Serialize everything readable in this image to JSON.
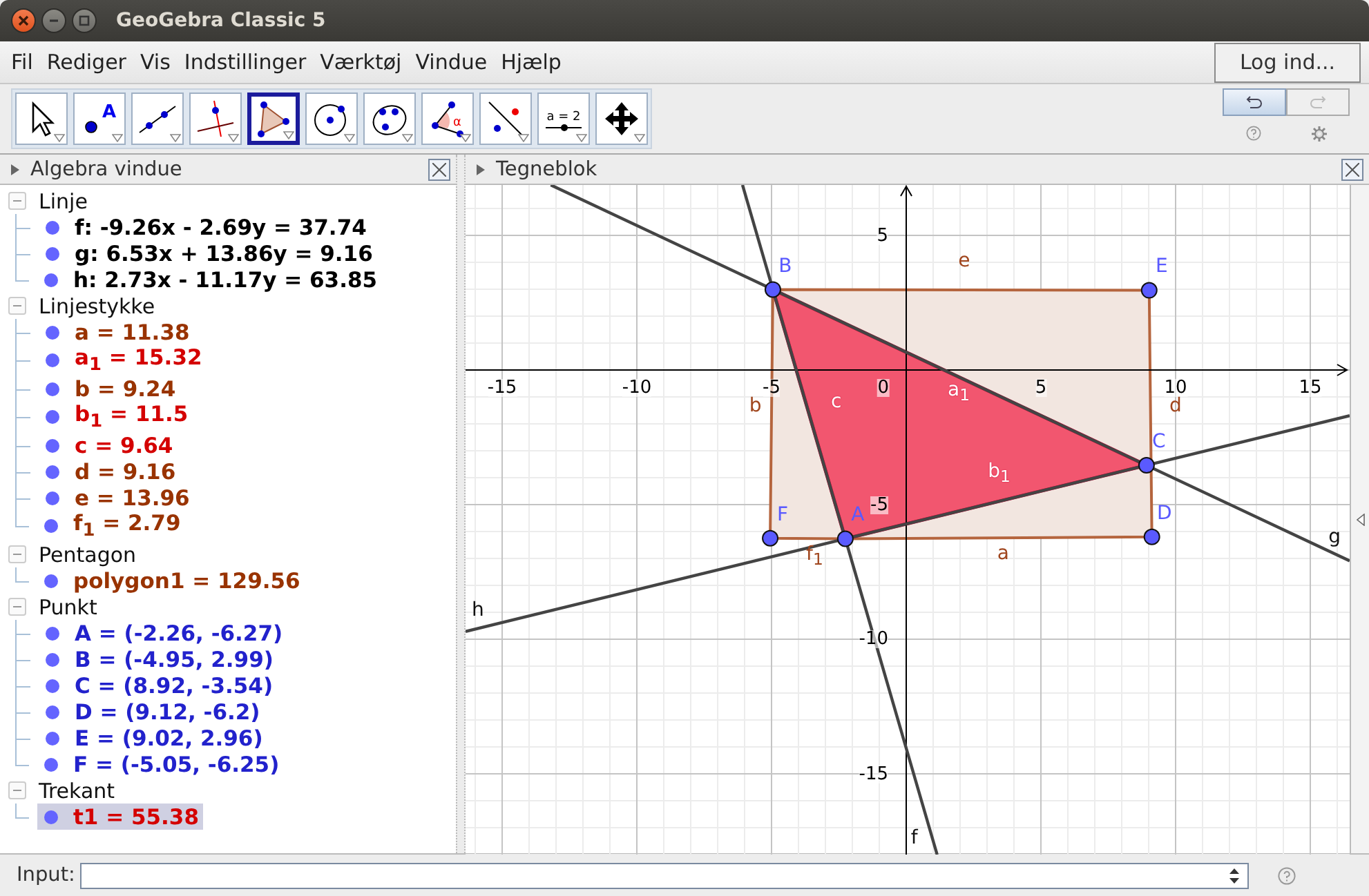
{
  "window": {
    "title": "GeoGebra Classic 5"
  },
  "menu": [
    "Fil",
    "Rediger",
    "Vis",
    "Indstillinger",
    "Værktøj",
    "Vindue",
    "Hjælp"
  ],
  "login_button": "Log ind...",
  "toolbar": {
    "tools": [
      {
        "kind": "move",
        "selected": false
      },
      {
        "kind": "point",
        "selected": false,
        "label": "A"
      },
      {
        "kind": "line",
        "selected": false
      },
      {
        "kind": "perpendicular",
        "selected": false
      },
      {
        "kind": "polygon",
        "selected": true
      },
      {
        "kind": "circle",
        "selected": false
      },
      {
        "kind": "conic",
        "selected": false
      },
      {
        "kind": "angle",
        "selected": false,
        "label": "α"
      },
      {
        "kind": "reflect",
        "selected": false
      },
      {
        "kind": "slider",
        "selected": false,
        "label": "a = 2"
      },
      {
        "kind": "move-view",
        "selected": false
      }
    ],
    "undo": {
      "disabled": false
    },
    "redo": {
      "disabled": true
    }
  },
  "algebra": {
    "title": "Algebra vindue",
    "groups": [
      {
        "label": "Linje",
        "expanded": true,
        "children": [
          {
            "text": "f: -9.26x - 2.69y = 37.74",
            "color": "#000000",
            "selected": false
          },
          {
            "text": "g: 6.53x + 13.86y = 9.16",
            "color": "#000000",
            "selected": false
          },
          {
            "text": "h: 2.73x - 11.17y = 63.85",
            "color": "#000000",
            "selected": false
          }
        ]
      },
      {
        "label": "Linjestykke",
        "expanded": true,
        "children": [
          {
            "text": "a = 11.38",
            "color": "#993300",
            "selected": false
          },
          {
            "text": "a$_{1}$ = 15.32",
            "color": "#d40000",
            "selected": false
          },
          {
            "text": "b = 9.24",
            "color": "#993300",
            "selected": false
          },
          {
            "text": "b$_{1}$ = 11.5",
            "color": "#d40000",
            "selected": false
          },
          {
            "text": "c = 9.64",
            "color": "#d40000",
            "selected": false
          },
          {
            "text": "d = 9.16",
            "color": "#993300",
            "selected": false
          },
          {
            "text": "e = 13.96",
            "color": "#993300",
            "selected": false
          },
          {
            "text": "f$_{1}$ = 2.79",
            "color": "#993300",
            "selected": false
          }
        ]
      },
      {
        "label": "Pentagon",
        "expanded": true,
        "children": [
          {
            "text": "polygon1 = 129.56",
            "color": "#993300",
            "selected": false
          }
        ]
      },
      {
        "label": "Punkt",
        "expanded": true,
        "children": [
          {
            "text": "A = (-2.26, -6.27)",
            "color": "#2222cc",
            "selected": false
          },
          {
            "text": "B = (-4.95, 2.99)",
            "color": "#2222cc",
            "selected": false
          },
          {
            "text": "C = (8.92, -3.54)",
            "color": "#2222cc",
            "selected": false
          },
          {
            "text": "D = (9.12, -6.2)",
            "color": "#2222cc",
            "selected": false
          },
          {
            "text": "E = (9.02, 2.96)",
            "color": "#2222cc",
            "selected": false
          },
          {
            "text": "F = (-5.05, -6.25)",
            "color": "#2222cc",
            "selected": false
          }
        ]
      },
      {
        "label": "Trekant",
        "expanded": true,
        "children": [
          {
            "text": "t1 = 55.38",
            "color": "#d40000",
            "selected": true
          }
        ]
      }
    ]
  },
  "graphics": {
    "title": "Tegneblok",
    "x_tick_labels": [
      "-15",
      "-10",
      "-5",
      "0",
      "5",
      "10",
      "15"
    ],
    "y_tick_labels": [
      "5",
      "-5",
      "-10",
      "-15"
    ],
    "labels": [
      {
        "text": "B",
        "kind": "point"
      },
      {
        "text": "e",
        "kind": "segment"
      },
      {
        "text": "E",
        "kind": "point"
      },
      {
        "text": "b",
        "kind": "segment"
      },
      {
        "text": "c",
        "kind": "triangle-side"
      },
      {
        "text": "a$_{1}$",
        "kind": "triangle-side"
      },
      {
        "text": "d",
        "kind": "segment"
      },
      {
        "text": "C",
        "kind": "point"
      },
      {
        "text": "b$_{1}$",
        "kind": "triangle-side"
      },
      {
        "text": "F",
        "kind": "point"
      },
      {
        "text": "A",
        "kind": "point"
      },
      {
        "text": "D",
        "kind": "point"
      },
      {
        "text": "g",
        "kind": "line"
      },
      {
        "text": "a",
        "kind": "segment"
      },
      {
        "text": "f$_{1}$",
        "kind": "segment"
      },
      {
        "text": "h",
        "kind": "line"
      },
      {
        "text": "f",
        "kind": "line"
      }
    ]
  },
  "input_bar": {
    "label": "Input:"
  }
}
